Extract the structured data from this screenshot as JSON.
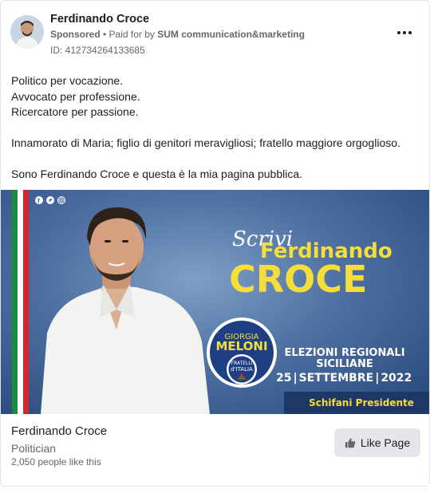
{
  "header": {
    "page_name": "Ferdinando Croce",
    "sponsored": "Sponsored",
    "separator": " • ",
    "paid_for_prefix": "Paid for by ",
    "payer": "SUM communication&marketing",
    "ad_id": "ID: 412734264133685",
    "more_icon": "more-horizontal-icon"
  },
  "post": {
    "lines": [
      "Politico per vocazione.",
      "Avvocato per professione.",
      "Ricercatore per passione.",
      "",
      "Innamorato di Maria; figlio di genitori meravigliosi; fratello maggiore orgoglioso.",
      "",
      "Sono Ferdinando Croce e questa è la mia pagina pubblica."
    ]
  },
  "creative": {
    "script_word": "Scrivi",
    "first_name": "Ferdinando",
    "last_name": "CROCE",
    "logo_top": "GIORGIA",
    "logo_name": "MELONI",
    "logo_party_1": "FRATELLI",
    "logo_party_2": "d'ITALIA",
    "election_line_1": "ELEZIONI REGIONALI",
    "election_line_2": "SICILIANE",
    "date_day": "25",
    "date_month": "SETTEMBRE",
    "date_year": "2022",
    "footer": "Schifani Presidente",
    "social_icons": [
      "facebook-icon",
      "twitter-icon",
      "instagram-icon"
    ],
    "colors": {
      "accent_yellow": "#f5dd3c",
      "flag_green": "#1e8a3c",
      "flag_red": "#d4262c",
      "bg_blue": "#3f6497"
    }
  },
  "cta": {
    "name": "Ferdinando Croce",
    "category": "Politician",
    "likes": "2,050 people like this",
    "button_label": "Like Page",
    "button_icon": "thumbs-up-icon"
  }
}
